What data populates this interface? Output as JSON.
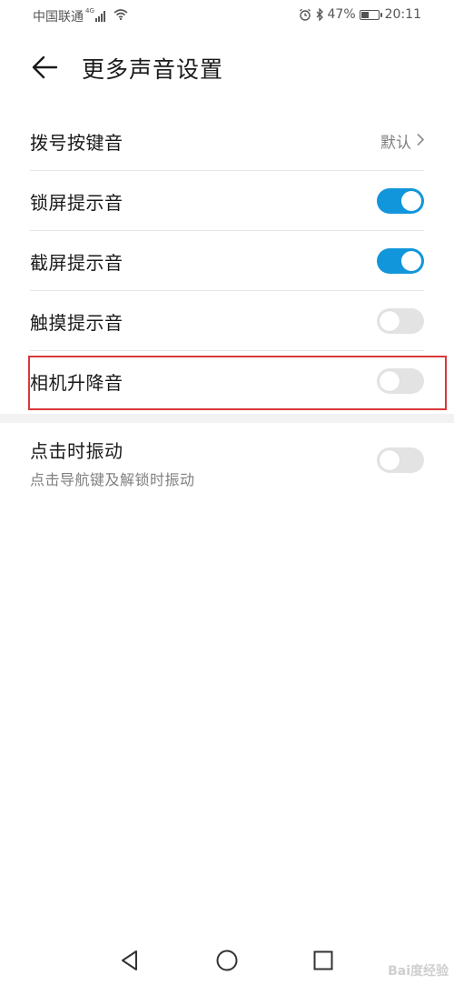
{
  "status_bar": {
    "carrier": "中国联通",
    "network_type": "4G",
    "battery_percent": "47%",
    "battery_level": 0.47,
    "time": "20:11",
    "icons": [
      "signal-icon",
      "wifi-icon",
      "alarm-icon",
      "bluetooth-icon",
      "battery-icon"
    ]
  },
  "header": {
    "back_icon": "back-arrow-icon",
    "title": "更多声音设置"
  },
  "settings": {
    "dial_tone": {
      "label": "拨号按键音",
      "value": "默认"
    },
    "lock_sound": {
      "label": "锁屏提示音",
      "enabled": true
    },
    "screenshot_sound": {
      "label": "截屏提示音",
      "enabled": true
    },
    "touch_sound": {
      "label": "触摸提示音",
      "enabled": false
    },
    "camera_lift_sound": {
      "label": "相机升降音",
      "enabled": false
    },
    "vibrate_on_tap": {
      "label": "点击时振动",
      "description": "点击导航键及解锁时振动",
      "enabled": false
    }
  },
  "colors": {
    "switch_on": "#1296db",
    "switch_off": "#e3e3e3",
    "highlight": "#d9383b"
  },
  "nav_bar": {
    "icons": [
      "nav-back-icon",
      "nav-home-icon",
      "nav-recent-icon"
    ]
  },
  "watermark": {
    "text": "Bai度经验"
  }
}
